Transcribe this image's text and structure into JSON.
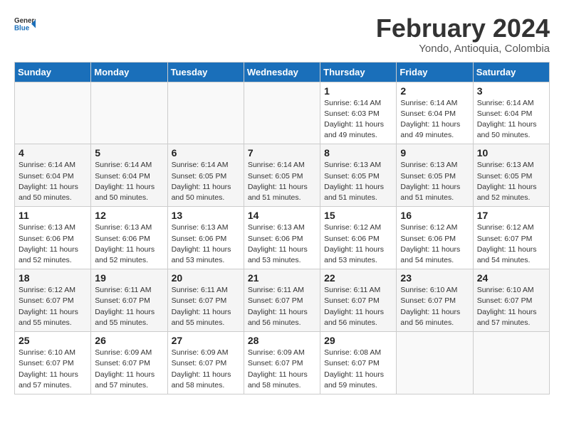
{
  "header": {
    "logo_general": "General",
    "logo_blue": "Blue",
    "title": "February 2024",
    "subtitle": "Yondo, Antioquia, Colombia"
  },
  "weekdays": [
    "Sunday",
    "Monday",
    "Tuesday",
    "Wednesday",
    "Thursday",
    "Friday",
    "Saturday"
  ],
  "weeks": [
    [
      {
        "day": "",
        "info": ""
      },
      {
        "day": "",
        "info": ""
      },
      {
        "day": "",
        "info": ""
      },
      {
        "day": "",
        "info": ""
      },
      {
        "day": "1",
        "info": "Sunrise: 6:14 AM\nSunset: 6:03 PM\nDaylight: 11 hours\nand 49 minutes."
      },
      {
        "day": "2",
        "info": "Sunrise: 6:14 AM\nSunset: 6:04 PM\nDaylight: 11 hours\nand 49 minutes."
      },
      {
        "day": "3",
        "info": "Sunrise: 6:14 AM\nSunset: 6:04 PM\nDaylight: 11 hours\nand 50 minutes."
      }
    ],
    [
      {
        "day": "4",
        "info": "Sunrise: 6:14 AM\nSunset: 6:04 PM\nDaylight: 11 hours\nand 50 minutes."
      },
      {
        "day": "5",
        "info": "Sunrise: 6:14 AM\nSunset: 6:04 PM\nDaylight: 11 hours\nand 50 minutes."
      },
      {
        "day": "6",
        "info": "Sunrise: 6:14 AM\nSunset: 6:05 PM\nDaylight: 11 hours\nand 50 minutes."
      },
      {
        "day": "7",
        "info": "Sunrise: 6:14 AM\nSunset: 6:05 PM\nDaylight: 11 hours\nand 51 minutes."
      },
      {
        "day": "8",
        "info": "Sunrise: 6:13 AM\nSunset: 6:05 PM\nDaylight: 11 hours\nand 51 minutes."
      },
      {
        "day": "9",
        "info": "Sunrise: 6:13 AM\nSunset: 6:05 PM\nDaylight: 11 hours\nand 51 minutes."
      },
      {
        "day": "10",
        "info": "Sunrise: 6:13 AM\nSunset: 6:05 PM\nDaylight: 11 hours\nand 52 minutes."
      }
    ],
    [
      {
        "day": "11",
        "info": "Sunrise: 6:13 AM\nSunset: 6:06 PM\nDaylight: 11 hours\nand 52 minutes."
      },
      {
        "day": "12",
        "info": "Sunrise: 6:13 AM\nSunset: 6:06 PM\nDaylight: 11 hours\nand 52 minutes."
      },
      {
        "day": "13",
        "info": "Sunrise: 6:13 AM\nSunset: 6:06 PM\nDaylight: 11 hours\nand 53 minutes."
      },
      {
        "day": "14",
        "info": "Sunrise: 6:13 AM\nSunset: 6:06 PM\nDaylight: 11 hours\nand 53 minutes."
      },
      {
        "day": "15",
        "info": "Sunrise: 6:12 AM\nSunset: 6:06 PM\nDaylight: 11 hours\nand 53 minutes."
      },
      {
        "day": "16",
        "info": "Sunrise: 6:12 AM\nSunset: 6:06 PM\nDaylight: 11 hours\nand 54 minutes."
      },
      {
        "day": "17",
        "info": "Sunrise: 6:12 AM\nSunset: 6:07 PM\nDaylight: 11 hours\nand 54 minutes."
      }
    ],
    [
      {
        "day": "18",
        "info": "Sunrise: 6:12 AM\nSunset: 6:07 PM\nDaylight: 11 hours\nand 55 minutes."
      },
      {
        "day": "19",
        "info": "Sunrise: 6:11 AM\nSunset: 6:07 PM\nDaylight: 11 hours\nand 55 minutes."
      },
      {
        "day": "20",
        "info": "Sunrise: 6:11 AM\nSunset: 6:07 PM\nDaylight: 11 hours\nand 55 minutes."
      },
      {
        "day": "21",
        "info": "Sunrise: 6:11 AM\nSunset: 6:07 PM\nDaylight: 11 hours\nand 56 minutes."
      },
      {
        "day": "22",
        "info": "Sunrise: 6:11 AM\nSunset: 6:07 PM\nDaylight: 11 hours\nand 56 minutes."
      },
      {
        "day": "23",
        "info": "Sunrise: 6:10 AM\nSunset: 6:07 PM\nDaylight: 11 hours\nand 56 minutes."
      },
      {
        "day": "24",
        "info": "Sunrise: 6:10 AM\nSunset: 6:07 PM\nDaylight: 11 hours\nand 57 minutes."
      }
    ],
    [
      {
        "day": "25",
        "info": "Sunrise: 6:10 AM\nSunset: 6:07 PM\nDaylight: 11 hours\nand 57 minutes."
      },
      {
        "day": "26",
        "info": "Sunrise: 6:09 AM\nSunset: 6:07 PM\nDaylight: 11 hours\nand 57 minutes."
      },
      {
        "day": "27",
        "info": "Sunrise: 6:09 AM\nSunset: 6:07 PM\nDaylight: 11 hours\nand 58 minutes."
      },
      {
        "day": "28",
        "info": "Sunrise: 6:09 AM\nSunset: 6:07 PM\nDaylight: 11 hours\nand 58 minutes."
      },
      {
        "day": "29",
        "info": "Sunrise: 6:08 AM\nSunset: 6:07 PM\nDaylight: 11 hours\nand 59 minutes."
      },
      {
        "day": "",
        "info": ""
      },
      {
        "day": "",
        "info": ""
      }
    ]
  ]
}
